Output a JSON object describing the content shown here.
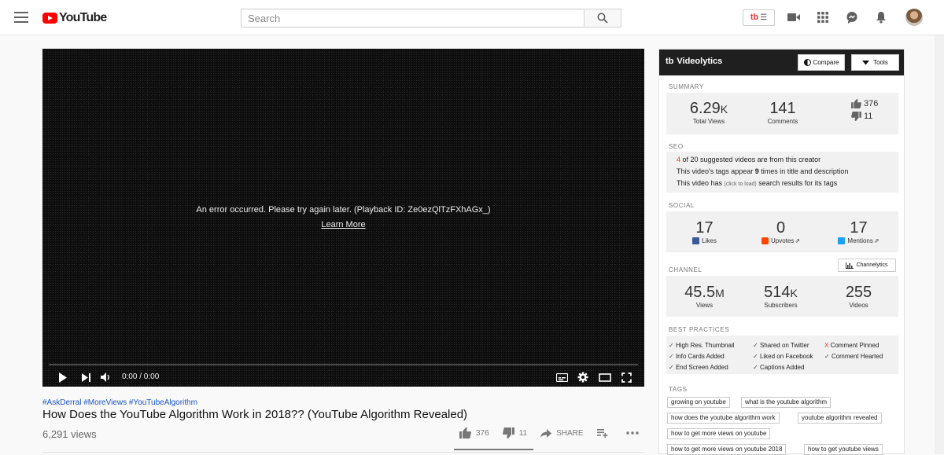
{
  "header": {
    "logo_text": "YouTube",
    "search_placeholder": "Search",
    "extension_badge": "tb"
  },
  "player": {
    "error_message": "An error occurred. Please try again later. (Playback ID: Ze0ezQlTzFXhAGx_)",
    "learn_more": "Learn More",
    "time": "0:00 / 0:00"
  },
  "video": {
    "hashtags": "#AskDerral #MoreViews #YouTubeAlgorithm",
    "title": "How Does the YouTube Algorithm Work in 2018?? (YouTube Algorithm Revealed)",
    "views": "6,291 views",
    "likes": "376",
    "dislikes": "11",
    "share_label": "SHARE"
  },
  "videolytics": {
    "title": "Videolytics",
    "logo": "tb",
    "compare_label": "Compare",
    "tools_label": "Tools",
    "summary": {
      "section": "SUMMARY",
      "total_views_num": "6.29",
      "total_views_suffix": "K",
      "total_views_label": "Total Views",
      "comments_num": "141",
      "comments_label": "Comments",
      "likes": "376",
      "dislikes": "11"
    },
    "seo": {
      "section": "SEO",
      "line1_num": "4",
      "line1_text": " of 20 suggested videos are from this creator",
      "line2_pre": "This video's tags appear ",
      "line2_num": "9",
      "line2_post": " times in title and description",
      "line3_pre": "This video has ",
      "line3_small": "(click to load)",
      "line3_post": " search results for its tags"
    },
    "social": {
      "section": "SOCIAL",
      "likes_num": "17",
      "likes_label": "Likes",
      "upvotes_num": "0",
      "upvotes_label": "Upvotes",
      "mentions_num": "17",
      "mentions_label": "Mentions"
    },
    "channel": {
      "section": "CHANNEL",
      "channelytics_label": "Channelytics",
      "views_num": "45.5",
      "views_suffix": "M",
      "views_label": "Views",
      "subs_num": "514",
      "subs_suffix": "K",
      "subs_label": "Subscribers",
      "videos_num": "255",
      "videos_label": "Videos"
    },
    "best_practices": {
      "section": "BEST PRACTICES",
      "items": [
        {
          "mark": "✓",
          "label": "High Res. Thumbnail"
        },
        {
          "mark": "✓",
          "label": "Shared on Twitter"
        },
        {
          "mark": "X",
          "label": "Comment Pinned"
        },
        {
          "mark": "✓",
          "label": "Info Cards Added"
        },
        {
          "mark": "✓",
          "label": "Liked on Facebook"
        },
        {
          "mark": "✓",
          "label": "Comment Hearted"
        },
        {
          "mark": "✓",
          "label": "End Screen Added"
        },
        {
          "mark": "✓",
          "label": "Captions Added"
        }
      ]
    },
    "tags": {
      "section": "TAGS",
      "items": [
        "growing on youtube",
        "what is the youtube algorithm",
        "how does the youtube algorithm work",
        "youtube algorithm revealed",
        "how to get more views on youtube",
        "how to get more views on youtube 2018",
        "how to get youtube views"
      ]
    }
  }
}
